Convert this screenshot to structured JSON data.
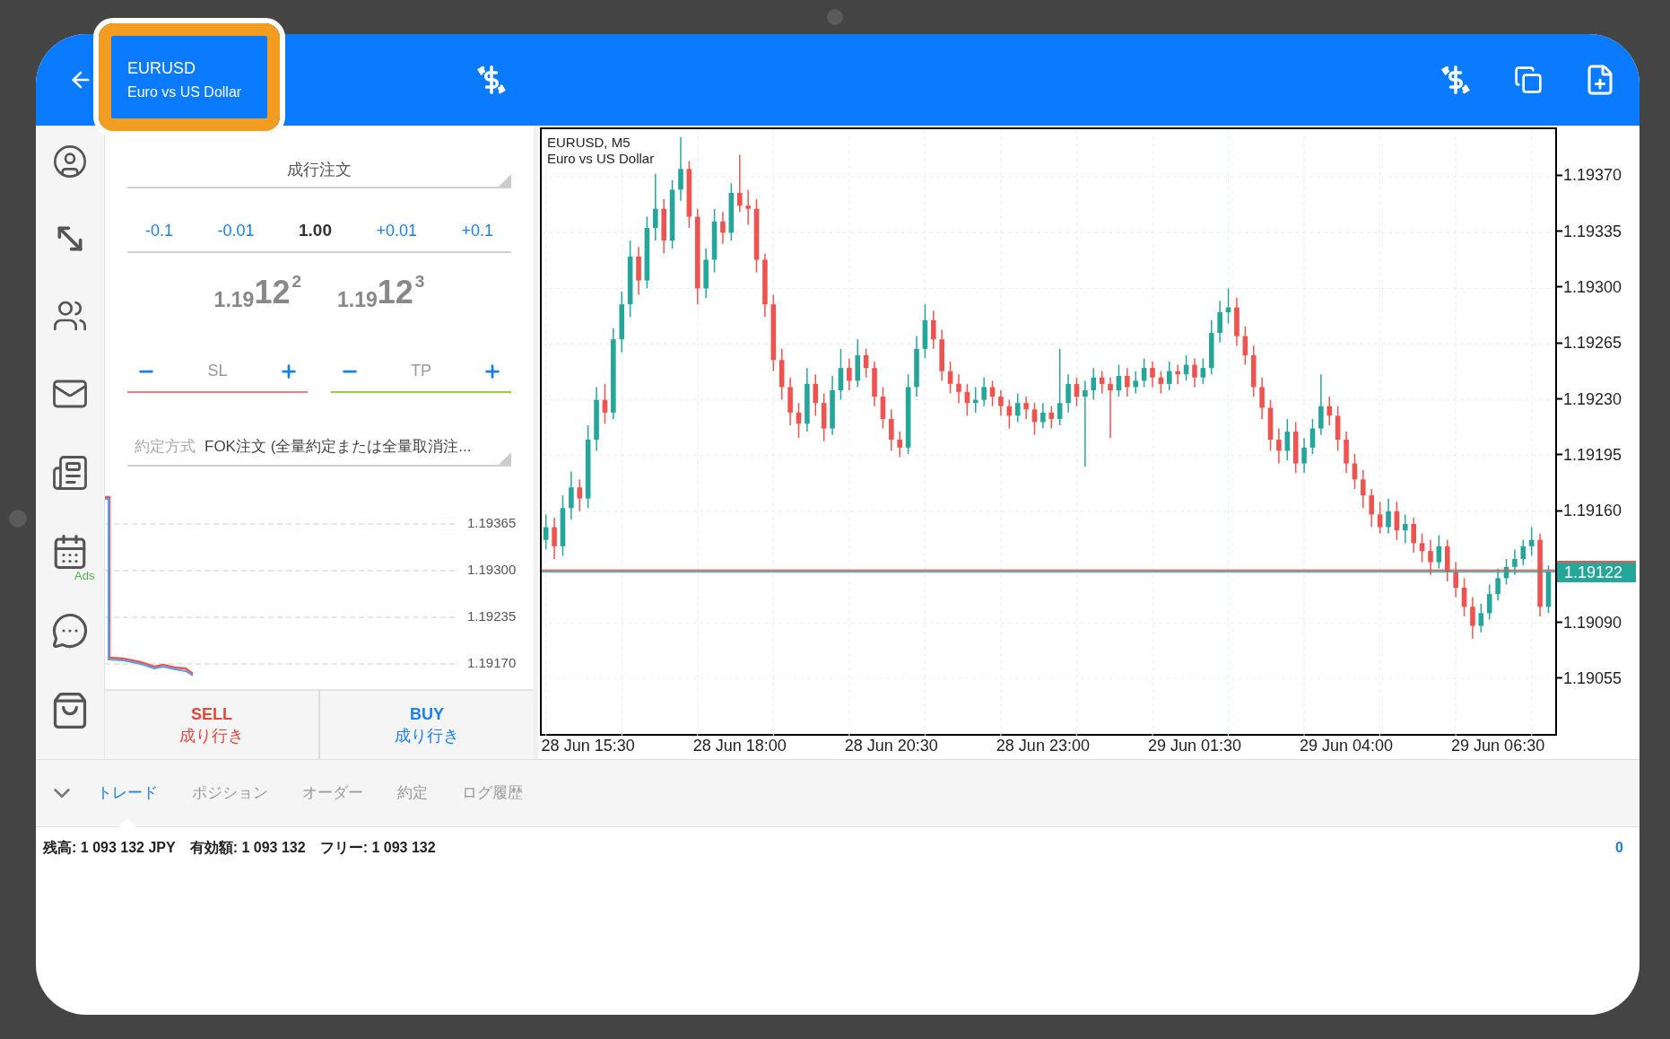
{
  "header": {
    "symbol": "EURUSD",
    "description": "Euro vs US Dollar",
    "highlighted": true
  },
  "sidebar": {
    "ads_label": "Ads"
  },
  "order_panel": {
    "order_type": "成行注文",
    "volume_steps": [
      {
        "label": "-0.1"
      },
      {
        "label": "-0.01"
      },
      {
        "label": "1.00",
        "kind": "value"
      },
      {
        "label": "+0.01"
      },
      {
        "label": "+0.1"
      }
    ],
    "bid": {
      "prefix": "1.19",
      "big": "12",
      "sup": "2"
    },
    "ask": {
      "prefix": "1.19",
      "big": "12",
      "sup": "3"
    },
    "stops": [
      {
        "label": "SL",
        "color": "#f08080"
      },
      {
        "label": "TP",
        "color": "#9acd32"
      }
    ],
    "filling": {
      "label": "約定方式",
      "value": "FOK注文 (全量約定または全量取消注..."
    },
    "mini_chart": {
      "y_labels": [
        "1.19365",
        "1.19300",
        "1.19235",
        "1.19170"
      ]
    },
    "sell": {
      "label": "SELL",
      "sub": "成り行き"
    },
    "buy": {
      "label": "BUY",
      "sub": "成り行き"
    }
  },
  "chart": {
    "symbol_line": "EURUSD, M5",
    "description": "Euro vs US Dollar",
    "current_price": "1.19122",
    "chart_data": {
      "type": "candlestick",
      "ylim": [
        1.19019,
        1.194
      ],
      "grid": true,
      "ref_lines": [
        {
          "axis": "y",
          "value": 1.19123,
          "color": "#ef5350"
        },
        {
          "axis": "y",
          "value": 1.19122,
          "color": "#26a69a"
        }
      ],
      "categories": [
        null,
        null,
        null,
        null,
        null,
        "28 Jun 15:30",
        null,
        null,
        null,
        null,
        null,
        null,
        null,
        null,
        null,
        null,
        null,
        null,
        null,
        null,
        null,
        null,
        null,
        "28 Jun 18:00",
        null,
        null,
        null,
        null,
        null,
        null,
        null,
        null,
        null,
        null,
        null,
        null,
        null,
        null,
        null,
        null,
        null,
        "28 Jun 20:30",
        null,
        null,
        null,
        null,
        null,
        null,
        null,
        null,
        null,
        null,
        null,
        null,
        null,
        null,
        null,
        null,
        null,
        "28 Jun 23:00",
        null,
        null,
        null,
        null,
        null,
        null,
        null,
        null,
        null,
        null,
        null,
        null,
        null,
        null,
        null,
        null,
        null,
        "29 Jun 01:30",
        null,
        null,
        null,
        null,
        null,
        null,
        null,
        null,
        null,
        null,
        null,
        null,
        null,
        null,
        null,
        null,
        null,
        "29 Jun 04:00",
        null,
        null,
        null,
        null,
        null,
        null,
        null,
        null,
        null,
        null,
        null,
        null,
        null,
        null,
        null,
        null,
        null,
        "29 Jun 06:30",
        null,
        null,
        null,
        null,
        null,
        null
      ],
      "yticks": [
        {
          "value": 1.1937,
          "label": "1.19370"
        },
        {
          "value": 1.19335,
          "label": "1.19335"
        },
        {
          "value": 1.193,
          "label": "1.19300"
        },
        {
          "value": 1.19265,
          "label": "1.19265"
        },
        {
          "value": 1.1923,
          "label": "1.19230"
        },
        {
          "value": 1.19195,
          "label": "1.19195"
        },
        {
          "value": 1.1916,
          "label": "1.19160"
        },
        {
          "value": 1.1909,
          "label": "1.19090"
        },
        {
          "value": 1.19055,
          "label": "1.19055"
        }
      ],
      "ohlc": [
        [
          1.19142,
          1.19158,
          1.19136,
          1.1915
        ],
        [
          1.1915,
          1.19156,
          1.1913,
          1.19138
        ],
        [
          1.19138,
          1.1917,
          1.19132,
          1.19162
        ],
        [
          1.19162,
          1.19185,
          1.19155,
          1.19175
        ],
        [
          1.19175,
          1.1918,
          1.1916,
          1.19168
        ],
        [
          1.19168,
          1.19214,
          1.19162,
          1.19205
        ],
        [
          1.19205,
          1.19238,
          1.19198,
          1.1923
        ],
        [
          1.1923,
          1.1924,
          1.19215,
          1.19222
        ],
        [
          1.19222,
          1.19275,
          1.19218,
          1.19268
        ],
        [
          1.19268,
          1.19298,
          1.1926,
          1.1929
        ],
        [
          1.1929,
          1.1933,
          1.19282,
          1.1932
        ],
        [
          1.1932,
          1.19326,
          1.19296,
          1.19305
        ],
        [
          1.19305,
          1.19345,
          1.193,
          1.19338
        ],
        [
          1.19338,
          1.19372,
          1.1933,
          1.1935
        ],
        [
          1.1935,
          1.19356,
          1.19322,
          1.1933
        ],
        [
          1.1933,
          1.19368,
          1.19325,
          1.19362
        ],
        [
          1.19362,
          1.19395,
          1.19355,
          1.19375
        ],
        [
          1.19375,
          1.1938,
          1.19338,
          1.19345
        ],
        [
          1.19345,
          1.1935,
          1.1929,
          1.193
        ],
        [
          1.193,
          1.19325,
          1.19294,
          1.19318
        ],
        [
          1.19318,
          1.1935,
          1.1931,
          1.19342
        ],
        [
          1.19342,
          1.19348,
          1.19328,
          1.19335
        ],
        [
          1.19335,
          1.19366,
          1.1933,
          1.1936
        ],
        [
          1.1936,
          1.19384,
          1.19348,
          1.19352
        ],
        [
          1.19352,
          1.19362,
          1.1934,
          1.1935
        ],
        [
          1.1935,
          1.19356,
          1.1931,
          1.19318
        ],
        [
          1.19318,
          1.19322,
          1.19282,
          1.1929
        ],
        [
          1.1929,
          1.19296,
          1.19248,
          1.19255
        ],
        [
          1.19255,
          1.19262,
          1.1923,
          1.19238
        ],
        [
          1.19238,
          1.19244,
          1.19214,
          1.19222
        ],
        [
          1.19222,
          1.19228,
          1.19206,
          1.19215
        ],
        [
          1.19215,
          1.1925,
          1.1921,
          1.1924
        ],
        [
          1.1924,
          1.19246,
          1.1922,
          1.19228
        ],
        [
          1.19228,
          1.19234,
          1.19204,
          1.19212
        ],
        [
          1.19212,
          1.19245,
          1.19208,
          1.19236
        ],
        [
          1.19236,
          1.19262,
          1.1923,
          1.1925
        ],
        [
          1.1925,
          1.19256,
          1.19236,
          1.19242
        ],
        [
          1.19242,
          1.19268,
          1.19238,
          1.19258
        ],
        [
          1.19258,
          1.19262,
          1.19244,
          1.1925
        ],
        [
          1.1925,
          1.19254,
          1.19226,
          1.19232
        ],
        [
          1.19232,
          1.19238,
          1.19212,
          1.19218
        ],
        [
          1.19218,
          1.19224,
          1.19198,
          1.19205
        ],
        [
          1.19205,
          1.1921,
          1.19194,
          1.192
        ],
        [
          1.192,
          1.19246,
          1.19196,
          1.19238
        ],
        [
          1.19238,
          1.1927,
          1.19232,
          1.19262
        ],
        [
          1.19262,
          1.1929,
          1.19256,
          1.1928
        ],
        [
          1.1928,
          1.19286,
          1.19262,
          1.19268
        ],
        [
          1.19268,
          1.19274,
          1.19242,
          1.19248
        ],
        [
          1.19248,
          1.19254,
          1.19234,
          1.1924
        ],
        [
          1.1924,
          1.19246,
          1.19228,
          1.19235
        ],
        [
          1.19235,
          1.1924,
          1.1922,
          1.19228
        ],
        [
          1.19228,
          1.19238,
          1.19222,
          1.1923
        ],
        [
          1.1923,
          1.19244,
          1.19226,
          1.19238
        ],
        [
          1.19238,
          1.19242,
          1.19226,
          1.19232
        ],
        [
          1.19232,
          1.19236,
          1.1922,
          1.19226
        ],
        [
          1.19226,
          1.1923,
          1.19212,
          1.1922
        ],
        [
          1.1922,
          1.19234,
          1.19216,
          1.19228
        ],
        [
          1.19228,
          1.19232,
          1.19218,
          1.19224
        ],
        [
          1.19224,
          1.19228,
          1.19208,
          1.19216
        ],
        [
          1.19216,
          1.19228,
          1.19212,
          1.19222
        ],
        [
          1.19222,
          1.19226,
          1.19212,
          1.19218
        ],
        [
          1.19218,
          1.19262,
          1.19214,
          1.19228
        ],
        [
          1.19228,
          1.19246,
          1.19222,
          1.1924
        ],
        [
          1.1924,
          1.19244,
          1.19226,
          1.19232
        ],
        [
          1.19232,
          1.19242,
          1.19188,
          1.19236
        ],
        [
          1.19236,
          1.1925,
          1.1923,
          1.19244
        ],
        [
          1.19244,
          1.19248,
          1.19234,
          1.1924
        ],
        [
          1.1924,
          1.19244,
          1.19206,
          1.19236
        ],
        [
          1.19236,
          1.19252,
          1.19232,
          1.19245
        ],
        [
          1.19245,
          1.1925,
          1.19232,
          1.19238
        ],
        [
          1.19238,
          1.19248,
          1.19234,
          1.19242
        ],
        [
          1.19242,
          1.19256,
          1.19238,
          1.1925
        ],
        [
          1.1925,
          1.19254,
          1.19238,
          1.19244
        ],
        [
          1.19244,
          1.19248,
          1.19234,
          1.1924
        ],
        [
          1.1924,
          1.19254,
          1.19236,
          1.19248
        ],
        [
          1.19248,
          1.19252,
          1.1924,
          1.19246
        ],
        [
          1.19246,
          1.19258,
          1.19242,
          1.19252
        ],
        [
          1.19252,
          1.19256,
          1.19238,
          1.19244
        ],
        [
          1.19244,
          1.19256,
          1.1924,
          1.1925
        ],
        [
          1.1925,
          1.1928,
          1.19246,
          1.19272
        ],
        [
          1.19272,
          1.19292,
          1.19266,
          1.19285
        ],
        [
          1.19285,
          1.193,
          1.19278,
          1.19288
        ],
        [
          1.19288,
          1.19294,
          1.19264,
          1.1927
        ],
        [
          1.1927,
          1.19276,
          1.19252,
          1.19258
        ],
        [
          1.19258,
          1.19264,
          1.19232,
          1.19238
        ],
        [
          1.19238,
          1.19244,
          1.19218,
          1.19225
        ],
        [
          1.19225,
          1.1923,
          1.19198,
          1.19205
        ],
        [
          1.19205,
          1.19212,
          1.1919,
          1.19198
        ],
        [
          1.19198,
          1.19218,
          1.19192,
          1.1921
        ],
        [
          1.1921,
          1.19216,
          1.19184,
          1.1919
        ],
        [
          1.1919,
          1.19206,
          1.19184,
          1.192
        ],
        [
          1.192,
          1.19218,
          1.19196,
          1.19212
        ],
        [
          1.19212,
          1.19246,
          1.19208,
          1.19226
        ],
        [
          1.19226,
          1.19232,
          1.19214,
          1.1922
        ],
        [
          1.1922,
          1.19226,
          1.19198,
          1.19205
        ],
        [
          1.19205,
          1.1921,
          1.19184,
          1.1919
        ],
        [
          1.1919,
          1.19196,
          1.19174,
          1.1918
        ],
        [
          1.1918,
          1.19186,
          1.19162,
          1.1917
        ],
        [
          1.1917,
          1.19174,
          1.1915,
          1.19158
        ],
        [
          1.19158,
          1.19166,
          1.19146,
          1.1915
        ],
        [
          1.1915,
          1.19168,
          1.19146,
          1.1916
        ],
        [
          1.1916,
          1.19166,
          1.19142,
          1.19148
        ],
        [
          1.19148,
          1.19158,
          1.1914,
          1.19152
        ],
        [
          1.19152,
          1.19156,
          1.19134,
          1.1914
        ],
        [
          1.1914,
          1.19146,
          1.19128,
          1.19135
        ],
        [
          1.19135,
          1.19142,
          1.1912,
          1.19128
        ],
        [
          1.19128,
          1.19145,
          1.19124,
          1.19138
        ],
        [
          1.19138,
          1.19142,
          1.19116,
          1.19122
        ],
        [
          1.19122,
          1.19128,
          1.19106,
          1.19112
        ],
        [
          1.19112,
          1.19118,
          1.19094,
          1.191
        ],
        [
          1.191,
          1.19106,
          1.1908,
          1.19088
        ],
        [
          1.19088,
          1.19102,
          1.19084,
          1.19096
        ],
        [
          1.19096,
          1.19114,
          1.19092,
          1.19108
        ],
        [
          1.19108,
          1.19124,
          1.19104,
          1.19118
        ],
        [
          1.19118,
          1.1913,
          1.19114,
          1.19125
        ],
        [
          1.19125,
          1.19136,
          1.1912,
          1.1913
        ],
        [
          1.1913,
          1.19142,
          1.19126,
          1.19138
        ],
        [
          1.19138,
          1.1915,
          1.19132,
          1.19142
        ],
        [
          1.19142,
          1.19146,
          1.19094,
          1.191
        ],
        [
          1.191,
          1.19126,
          1.19096,
          1.19122
        ]
      ]
    }
  },
  "tabs": [
    {
      "label": "トレード",
      "selected": true
    },
    {
      "label": "ポジション",
      "selected": false
    },
    {
      "label": "オーダー",
      "selected": false
    },
    {
      "label": "約定",
      "selected": false
    },
    {
      "label": "ログ履歴",
      "selected": false
    }
  ],
  "account": {
    "items": [
      {
        "label": "残高:",
        "value": "1 093 132 JPY"
      },
      {
        "label": "有効額:",
        "value": "1 093 132"
      },
      {
        "label": "フリー:",
        "value": "1 093 132"
      }
    ],
    "count": "0"
  }
}
